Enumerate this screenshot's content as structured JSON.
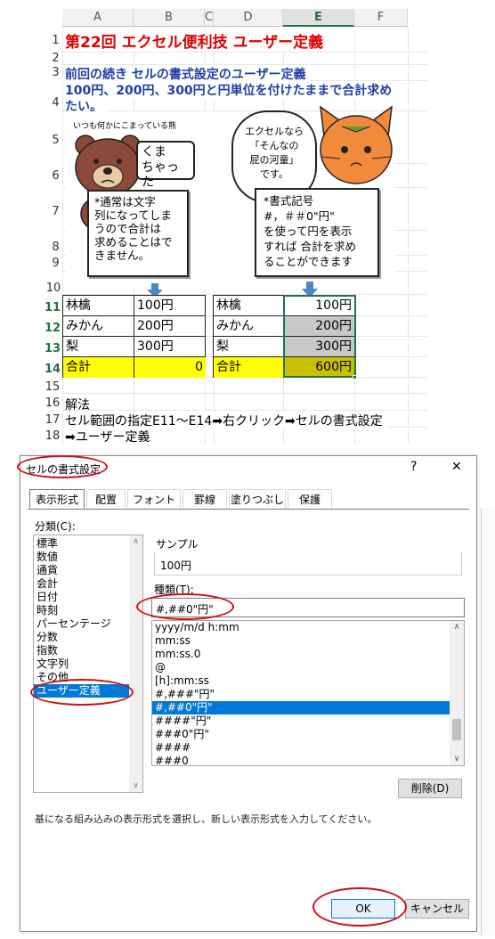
{
  "sheet": {
    "col_headers": [
      "A",
      "B",
      "C",
      "D",
      "E",
      "F"
    ],
    "selected_col": "E",
    "row_numbers": [
      "1",
      "2",
      "3",
      "4",
      "5",
      "6",
      "7",
      "8",
      "9",
      "10",
      "11",
      "12",
      "13",
      "14",
      "15",
      "16",
      "17",
      "18"
    ],
    "selected_rows": [
      "11",
      "12",
      "13",
      "14"
    ],
    "title": "第22回 エクセル便利技 ユーザー定義",
    "intro_line1": "前回の続き セルの書式設定のユーザー定義",
    "intro_line2": "100円、200円、300円と円単位を付けたままで合計求め",
    "intro_line3": "たい。",
    "bear_caption": "いつも何かにこまっている熊",
    "bear_speech": [
      "くま",
      "ちゃった"
    ],
    "bear_note": [
      "*通常は文字",
      "列になってしま",
      "うので合計は",
      "求めることはで",
      "きません。"
    ],
    "cat_speech": [
      "エクセルなら",
      "「そんなの",
      "屁の河童」",
      "です。"
    ],
    "cat_note": [
      "*書式記号",
      "#，＃＃0\"円\"",
      "を使って円を表示",
      "すれば 合計を求め",
      "ることができます"
    ],
    "left_table": [
      {
        "item": "林檎",
        "value": "100円"
      },
      {
        "item": "みかん",
        "value": "200円"
      },
      {
        "item": "梨",
        "value": "300円"
      },
      {
        "item": "合計",
        "value": "0"
      }
    ],
    "right_table": [
      {
        "item": "林檎",
        "value": "100円"
      },
      {
        "item": "みかん",
        "value": "200円"
      },
      {
        "item": "梨",
        "value": "300円"
      },
      {
        "item": "合計",
        "value": "600円"
      }
    ],
    "solution_label": "解法",
    "solution_line1": "セル範囲の指定E11～E14➡右クリック➡セルの書式設定",
    "solution_line2": "➡ユーザー定義",
    "colors": {
      "title_red": "#e00000",
      "intro_blue": "#1f3ea8",
      "total_yellow": "#ffff00",
      "selected_gray": "#c8c8c8",
      "selected_total": "#c8c000",
      "excel_green": "#217346"
    }
  },
  "dialog": {
    "title": "セルの書式設定",
    "help": "?",
    "close": "✕",
    "tabs": [
      "表示形式",
      "配置",
      "フォント",
      "罫線",
      "塗りつぶし",
      "保護"
    ],
    "active_tab": "表示形式",
    "category_label": "分類(C):",
    "categories": [
      "標準",
      "数値",
      "通貨",
      "会計",
      "日付",
      "時刻",
      "パーセンテージ",
      "分数",
      "指数",
      "文字列",
      "その他",
      "ユーザー定義"
    ],
    "selected_category": "ユーザー定義",
    "sample_label": "サンプル",
    "sample_value": "100円",
    "type_label": "種類(T):",
    "type_value": "#,##0\"円\"",
    "formats": [
      "yyyy/m/d h:mm",
      "mm:ss",
      "mm:ss.0",
      "@",
      "[h]:mm:ss",
      "#,###\"円\"",
      "#,##0\"円\"",
      "####\"円\"",
      "###0\"円\"",
      "####",
      "###0"
    ],
    "selected_format": "#,##0\"円\"",
    "delete_button": "削除(D)",
    "description": "基になる組み込みの表示形式を選択し、新しい表示形式を入力してください。",
    "ok_button": "OK",
    "cancel_button": "キャンセル",
    "highlight_color": "#d01010"
  }
}
